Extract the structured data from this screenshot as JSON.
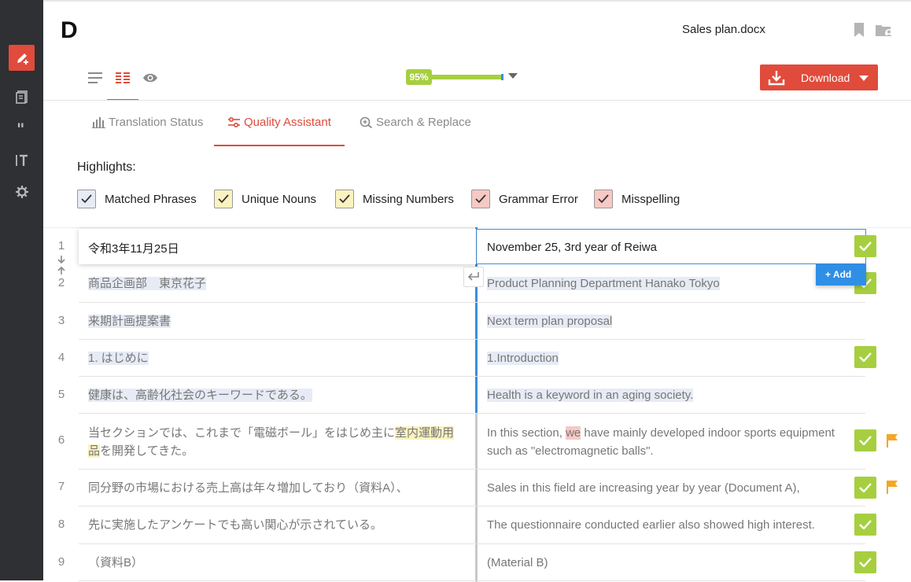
{
  "app": {
    "logo": "D",
    "filename": "Sales plan.docx",
    "progress_label": "95%",
    "progress_value": 0.95,
    "download_label": "Download"
  },
  "sidebar": {
    "items": [
      {
        "icon": "edit-icon",
        "active": true
      },
      {
        "icon": "document-icon",
        "active": false
      },
      {
        "icon": "quote-icon",
        "active": false
      },
      {
        "icon": "text-format-icon",
        "active": false
      },
      {
        "icon": "gear-icon",
        "active": false
      }
    ]
  },
  "view_modes": [
    {
      "icon": "list-icon",
      "active": false
    },
    {
      "icon": "side-by-side-icon",
      "active": true
    },
    {
      "icon": "eye-icon",
      "active": false
    }
  ],
  "tabs": [
    {
      "label": "Translation Status",
      "icon": "bar-chart-icon",
      "active": false
    },
    {
      "label": "Quality Assistant",
      "icon": "sliders-icon",
      "active": true
    },
    {
      "label": "Search & Replace",
      "icon": "search-plus-icon",
      "active": false
    }
  ],
  "highlights": {
    "title": "Highlights:",
    "items": [
      {
        "label": "Matched Phrases",
        "checked": true,
        "color": "#e6ebf5"
      },
      {
        "label": "Unique Nouns",
        "checked": true,
        "color": "#fbf2c0"
      },
      {
        "label": "Missing Numbers",
        "checked": true,
        "color": "#fbf2c0"
      },
      {
        "label": "Grammar Error",
        "checked": true,
        "color": "#f6c9c4"
      },
      {
        "label": "Misspelling",
        "checked": true,
        "color": "#f6c9c4"
      }
    ]
  },
  "segments": [
    {
      "num": "1",
      "source": "令和3年11月25日",
      "target": "November 25, 3rd year of Reiwa",
      "confirmed": true,
      "flag": false
    },
    {
      "num": "2",
      "source": "商品企画部　東京花子",
      "target": "Product Planning Department Hanako Tokyo",
      "confirmed": true,
      "flag": false
    },
    {
      "num": "3",
      "source": "来期計画提案書",
      "target": "Next term plan proposal",
      "confirmed": false,
      "flag": false
    },
    {
      "num": "4",
      "source": "1. はじめに",
      "target": "1.Introduction",
      "confirmed": true,
      "flag": false
    },
    {
      "num": "5",
      "source": "健康は、高齢化社会のキーワードである。",
      "target": "Health is a keyword in an aging society.",
      "confirmed": false,
      "flag": false
    },
    {
      "num": "6",
      "source_parts": [
        "当セクションでは、これまで「電磁ボール」をはじめ主に",
        "室内運動用品",
        "を開発してきた。"
      ],
      "target_parts": [
        "In this section, ",
        "we",
        " have mainly developed indoor sports equipment such as \"electromagnetic balls\"."
      ],
      "confirmed": true,
      "flag": true
    },
    {
      "num": "7",
      "source": "同分野の市場における売上高は年々増加しており（資料A）、",
      "target": "Sales in this field are increasing year by year (Document A),",
      "confirmed": true,
      "flag": true
    },
    {
      "num": "8",
      "source": "先に実施したアンケートでも高い関心が示されている。",
      "target": "The questionnaire conducted earlier also showed high interest.",
      "confirmed": true,
      "flag": false
    },
    {
      "num": "9",
      "source": "（資料B）",
      "target": "(Material B)",
      "confirmed": true,
      "flag": false
    }
  ],
  "add_button_label": "+ Add",
  "colors": {
    "accent": "#e04b3c",
    "confirm": "#a6cf3f",
    "active_blue": "#3a8fd9",
    "flag": "#f5a623",
    "sidebar_bg": "#2f3033"
  }
}
